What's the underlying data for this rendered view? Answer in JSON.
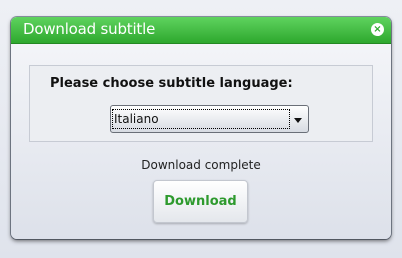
{
  "dialog": {
    "title": "Download subtitle",
    "close_icon": "close-icon",
    "accent_color": "#3cb83c"
  },
  "language": {
    "prompt": "Please choose subtitle language:",
    "selected": "Italiano"
  },
  "status": "Download complete",
  "download_button": "Download"
}
